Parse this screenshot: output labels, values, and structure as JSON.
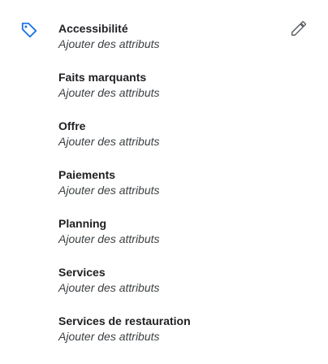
{
  "icons": {
    "tag": "tag-icon",
    "edit": "pencil-icon"
  },
  "colors": {
    "accent": "#1a73e8",
    "title": "#202124",
    "subtitle": "#3c4043",
    "icon_gray": "#5f6368"
  },
  "attributes": [
    {
      "title": "Accessibilité",
      "subtitle": "Ajouter des attributs"
    },
    {
      "title": "Faits marquants",
      "subtitle": "Ajouter des attributs"
    },
    {
      "title": "Offre",
      "subtitle": "Ajouter des attributs"
    },
    {
      "title": "Paiements",
      "subtitle": "Ajouter des attributs"
    },
    {
      "title": "Planning",
      "subtitle": "Ajouter des attributs"
    },
    {
      "title": "Services",
      "subtitle": "Ajouter des attributs"
    },
    {
      "title": "Services de restauration",
      "subtitle": "Ajouter des attributs"
    }
  ]
}
